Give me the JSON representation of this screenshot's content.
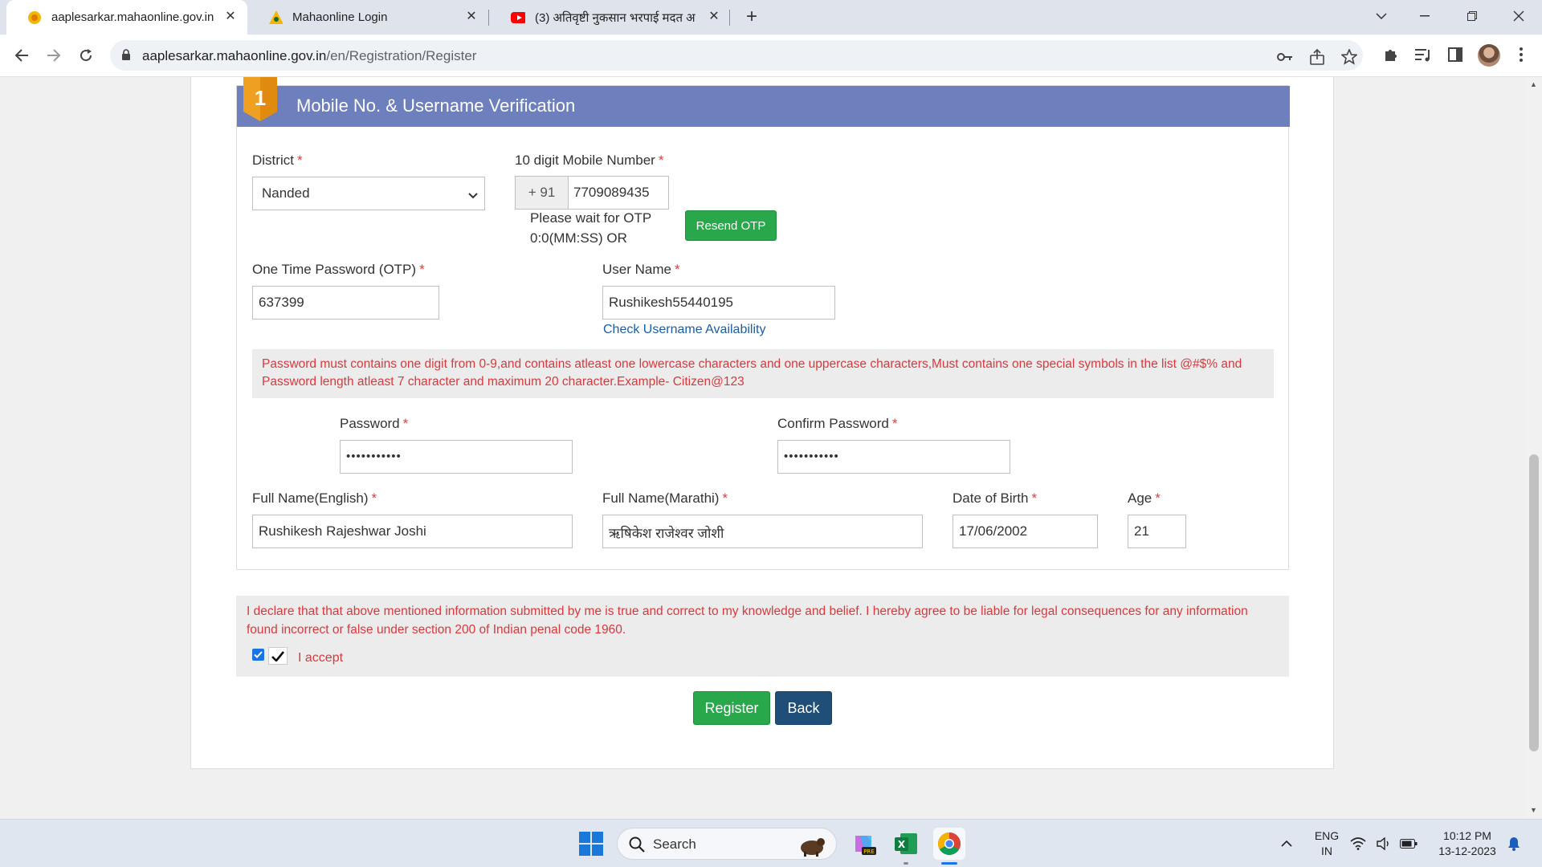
{
  "browser": {
    "tabs": [
      {
        "title": "aaplesarkar.mahaonline.gov.in",
        "active": true
      },
      {
        "title": "Mahaonline Login",
        "active": false
      },
      {
        "title": "(3) अतिवृष्टी नुकसान भरपाई मदत अ",
        "active": false
      }
    ],
    "url_host": "aaplesarkar.mahaonline.gov.in",
    "url_path": "/en/Registration/Register"
  },
  "form": {
    "section_number": "1",
    "section_title": "Mobile No. & Username Verification",
    "district_label": "District",
    "district_value": "Nanded",
    "mobile_label": "10 digit Mobile Number",
    "mobile_prefix": "+ 91",
    "mobile_value": "7709089435",
    "otp_wait_line1": "Please wait for OTP",
    "otp_wait_line2": "0:0(MM:SS) OR",
    "resend_otp": "Resend OTP",
    "otp_label": "One Time Password (OTP)",
    "otp_value": "637399",
    "username_label": "User Name",
    "username_value": "Rushikesh55440195",
    "check_username": "Check Username Availability",
    "password_note_line1": "Password must contains one digit from 0-9,and contains atleast one lowercase characters and one uppercase characters,Must contains one special symbols in the list @#$% and",
    "password_note_line2": "Password length atleast 7 character and maximum 20 character.Example- Citizen@123",
    "password_label": "Password",
    "password_value": "•••••••••••",
    "confirm_password_label": "Confirm Password",
    "confirm_password_value": "•••••••••••",
    "fullname_en_label": "Full Name(English)",
    "fullname_en_value": "Rushikesh Rajeshwar Joshi",
    "fullname_mr_label": "Full Name(Marathi)",
    "fullname_mr_value": "ऋषिकेश राजेश्वर जोशी",
    "dob_label": "Date of Birth",
    "dob_value": "17/06/2002",
    "age_label": "Age",
    "age_value": "21",
    "required_mark": "*"
  },
  "declaration": {
    "line1": "I declare that that above mentioned information submitted by me is true and correct to my knowledge and belief. I hereby agree to be liable for legal consequences for any information",
    "line2": "found incorrect or false under section 200 of Indian penal code 1960.",
    "accept_label": "I accept",
    "accepted": true
  },
  "actions": {
    "register": "Register",
    "back": "Back"
  },
  "taskbar": {
    "search_label": "Search",
    "lang_line1": "ENG",
    "lang_line2": "IN",
    "time": "10:12 PM",
    "date": "13-12-2023"
  },
  "colors": {
    "header": "#6e7fbd",
    "required": "#e03c3c",
    "note_text": "#d9393d",
    "register": "#28a84a",
    "back": "#1f4e79"
  }
}
